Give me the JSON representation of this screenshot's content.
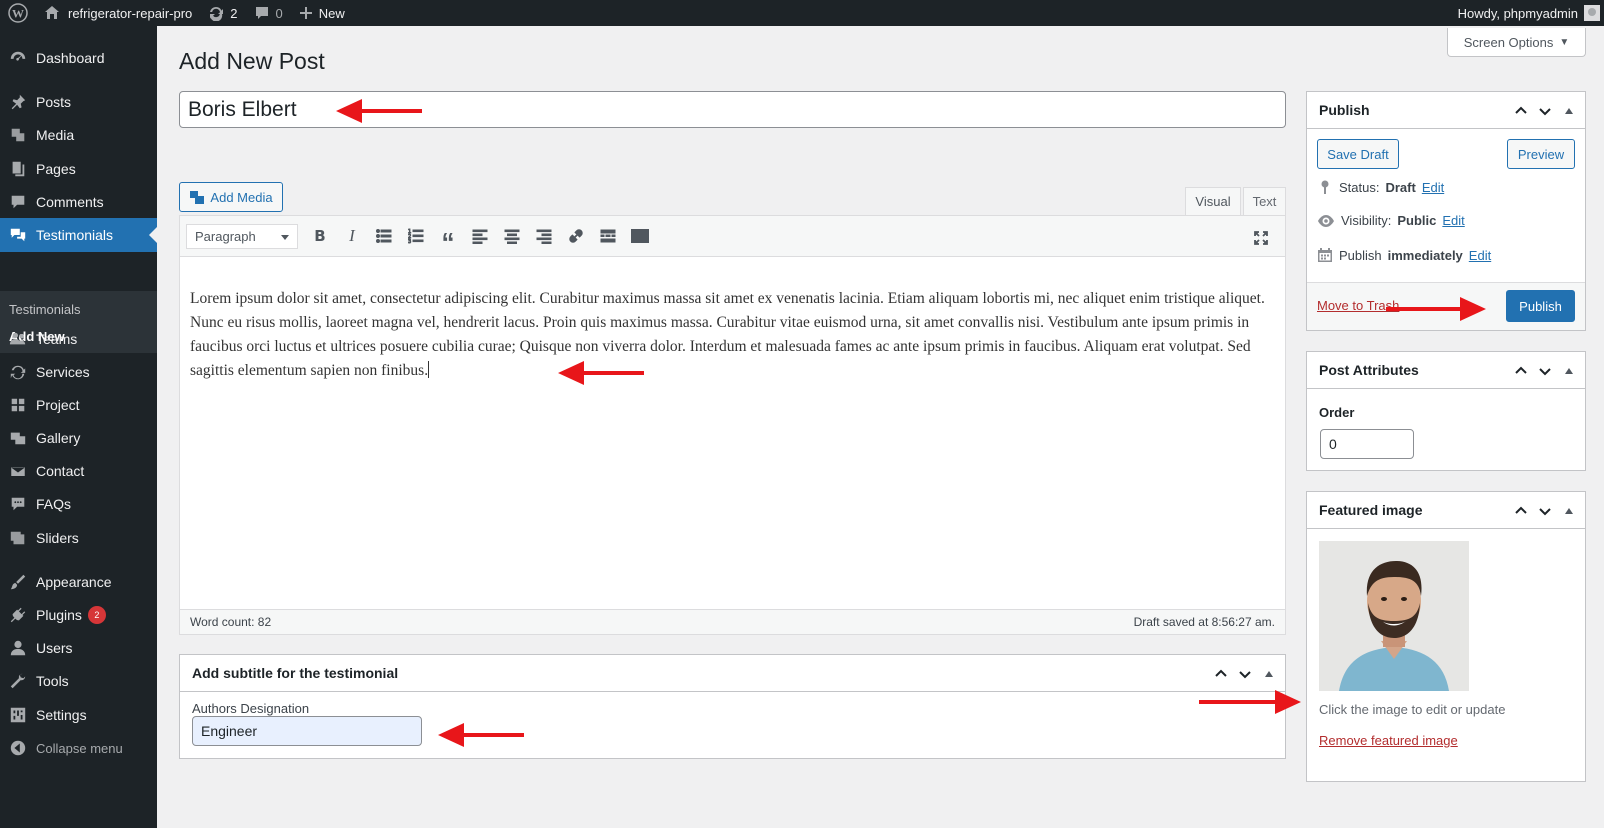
{
  "admin_bar": {
    "site_name": "refrigerator-repair-pro",
    "updates_count": "2",
    "comments_count": "0",
    "new_label": "New",
    "greeting": "Howdy, phpmyadmin"
  },
  "sidebar": {
    "items": [
      {
        "label": "Dashboard",
        "icon": "dashboard-icon"
      },
      {
        "label": "Posts",
        "icon": "pin-icon"
      },
      {
        "label": "Media",
        "icon": "media-icon"
      },
      {
        "label": "Pages",
        "icon": "pages-icon"
      },
      {
        "label": "Comments",
        "icon": "comment-icon"
      },
      {
        "label": "Testimonials",
        "icon": "testimonial-icon"
      },
      {
        "label": "Teams",
        "icon": "groups-icon"
      },
      {
        "label": "Services",
        "icon": "services-icon"
      },
      {
        "label": "Project",
        "icon": "grid-icon"
      },
      {
        "label": "Gallery",
        "icon": "gallery-icon"
      },
      {
        "label": "Contact",
        "icon": "email-icon"
      },
      {
        "label": "FAQs",
        "icon": "faq-icon"
      },
      {
        "label": "Sliders",
        "icon": "slides-icon"
      },
      {
        "label": "Appearance",
        "icon": "brush-icon"
      },
      {
        "label": "Plugins",
        "icon": "plugin-icon",
        "badge": "2"
      },
      {
        "label": "Users",
        "icon": "users-icon"
      },
      {
        "label": "Tools",
        "icon": "wrench-icon"
      },
      {
        "label": "Settings",
        "icon": "settings-icon"
      }
    ],
    "submenu": [
      "Testimonials",
      "Add New"
    ],
    "collapse_label": "Collapse menu"
  },
  "screen_options_label": "Screen Options",
  "page_title": "Add New Post",
  "post_title": "Boris Elbert",
  "editor": {
    "add_media_label": "Add Media",
    "tab_visual": "Visual",
    "tab_text": "Text",
    "format_value": "Paragraph",
    "content": "Lorem ipsum dolor sit amet, consectetur adipiscing elit. Curabitur maximus massa sit amet ex venenatis lacinia. Etiam aliquam lobortis mi, nec aliquet enim tristique aliquet. Nunc eu risus mollis, laoreet magna vel, hendrerit lacus. Proin quis maximus massa. Curabitur vitae euismod urna, sit amet convallis nisi. Vestibulum ante ipsum primis in faucibus orci luctus et ultrices posuere cubilia curae; Quisque non viverra dolor. Interdum et malesuada fames ac ante ipsum primis in faucibus. Aliquam erat volutpat. Sed sagittis elementum sapien non finibus.",
    "word_count": "Word count: 82",
    "draft_saved": "Draft saved at 8:56:27 am."
  },
  "subtitle_box": {
    "title": "Add subtitle for the testimonial",
    "field_label": "Authors Designation",
    "field_value": "Engineer"
  },
  "publish_box": {
    "title": "Publish",
    "save_draft": "Save Draft",
    "preview": "Preview",
    "status_label": "Status:",
    "status_value": "Draft",
    "visibility_label": "Visibility:",
    "visibility_value": "Public",
    "publish_label": "Publish",
    "publish_when": "immediately",
    "edit": "Edit",
    "move_to_trash": "Move to Trash",
    "publish_button": "Publish"
  },
  "attributes_box": {
    "title": "Post Attributes",
    "order_label": "Order",
    "order_value": "0"
  },
  "featured_box": {
    "title": "Featured image",
    "hint": "Click the image to edit or update",
    "remove": "Remove featured image"
  },
  "colors": {
    "accent": "#2271b1",
    "sidebar_bg": "#1d2327",
    "annotation_arrow": "#e8161a"
  }
}
